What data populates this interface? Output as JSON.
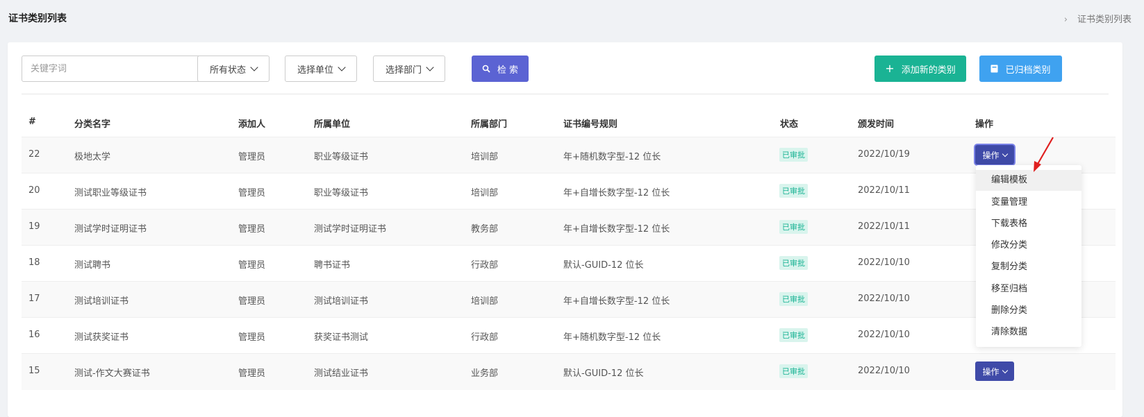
{
  "header": {
    "title": "证书类别列表",
    "breadcrumb": "证书类别列表"
  },
  "toolbar": {
    "keyword_placeholder": "关键字词",
    "status_filter": "所有状态",
    "unit_filter": "选择单位",
    "dept_filter": "选择部门",
    "search_label": "检 索",
    "add_label": "添加新的类别",
    "archived_label": "已归档类别"
  },
  "table": {
    "columns": [
      "#",
      "分类名字",
      "添加人",
      "所属单位",
      "所属部门",
      "证书编号规则",
      "状态",
      "颁发时间",
      "操作"
    ],
    "rows": [
      {
        "id": "22",
        "name": "极地太学",
        "creator": "管理员",
        "unit": "职业等级证书",
        "dept": "培训部",
        "rule": "年+随机数字型-12 位长",
        "status": "已审批",
        "date": "2022/10/19",
        "action": "操作"
      },
      {
        "id": "20",
        "name": "测试职业等级证书",
        "creator": "管理员",
        "unit": "职业等级证书",
        "dept": "培训部",
        "rule": "年+自增长数字型-12 位长",
        "status": "已审批",
        "date": "2022/10/11",
        "action": ""
      },
      {
        "id": "19",
        "name": "测试学时证明证书",
        "creator": "管理员",
        "unit": "测试学时证明证书",
        "dept": "教务部",
        "rule": "年+自增长数字型-12 位长",
        "status": "已审批",
        "date": "2022/10/11",
        "action": ""
      },
      {
        "id": "18",
        "name": "测试聘书",
        "creator": "管理员",
        "unit": "聘书证书",
        "dept": "行政部",
        "rule": "默认-GUID-12 位长",
        "status": "已审批",
        "date": "2022/10/10",
        "action": ""
      },
      {
        "id": "17",
        "name": "测试培训证书",
        "creator": "管理员",
        "unit": "测试培训证书",
        "dept": "培训部",
        "rule": "年+自增长数字型-12 位长",
        "status": "已审批",
        "date": "2022/10/10",
        "action": ""
      },
      {
        "id": "16",
        "name": "测试获奖证书",
        "creator": "管理员",
        "unit": "获奖证书测试",
        "dept": "行政部",
        "rule": "年+随机数字型-12 位长",
        "status": "已审批",
        "date": "2022/10/10",
        "action": ""
      },
      {
        "id": "15",
        "name": "测试-作文大赛证书",
        "creator": "管理员",
        "unit": "测试结业证书",
        "dept": "业务部",
        "rule": "默认-GUID-12 位长",
        "status": "已审批",
        "date": "2022/10/10",
        "action": "操作"
      }
    ]
  },
  "dropdown_menu": {
    "items": [
      "编辑模板",
      "变量管理",
      "下载表格",
      "修改分类",
      "复制分类",
      "移至归档",
      "删除分类",
      "清除数据"
    ]
  },
  "icons": {
    "search": "search-icon",
    "add": "plus-icon",
    "archive": "archive-icon",
    "annotation": "red-arrow-pointer"
  },
  "colors": {
    "primary": "#5b63d3",
    "success": "#1ab394",
    "info": "#3fa2f0",
    "operation": "#3f4aa8",
    "badge_bg": "#d9f4ed",
    "annotation": "#e02020"
  }
}
